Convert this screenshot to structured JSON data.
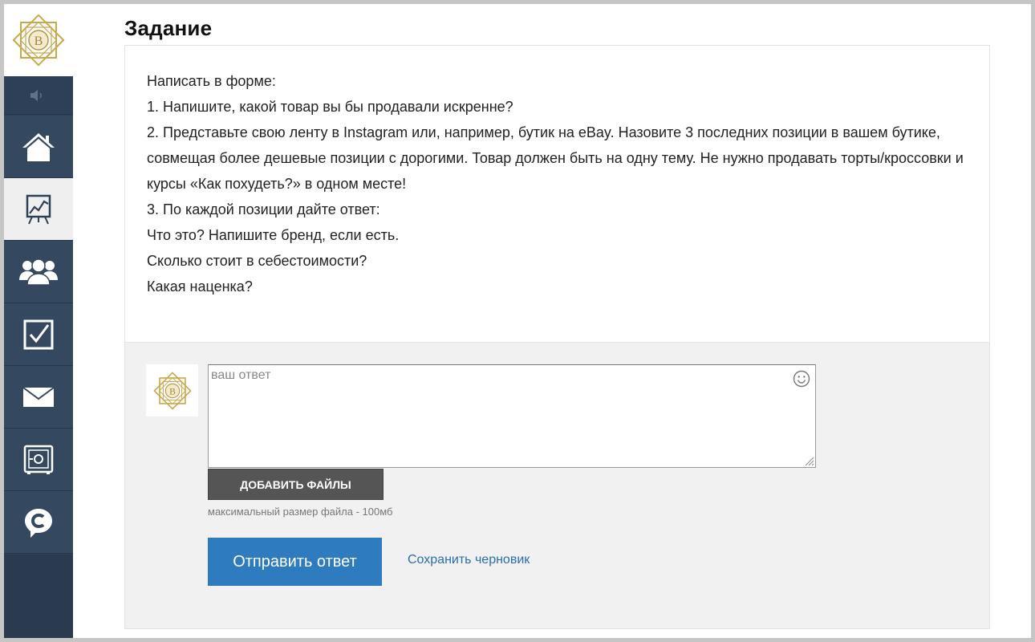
{
  "page": {
    "title": "Задание"
  },
  "sidebar": {
    "items": [
      {
        "name": "home",
        "icon": "home-icon",
        "active": false
      },
      {
        "name": "presentation",
        "icon": "presentation-chart-icon",
        "active": true
      },
      {
        "name": "users",
        "icon": "users-group-icon",
        "active": false
      },
      {
        "name": "tasks",
        "icon": "checkbox-icon",
        "active": false
      },
      {
        "name": "messages",
        "icon": "envelope-icon",
        "active": false
      },
      {
        "name": "safe",
        "icon": "safe-icon",
        "active": false
      },
      {
        "name": "chat",
        "icon": "chat-c-icon",
        "active": false
      }
    ]
  },
  "task": {
    "lines": [
      "Написать в форме:",
      "1. Напишите, какой товар вы бы продавали искренне?",
      "2. Представьте свою ленту в Instagram или, например, бутик на eBay. Назовите 3 последних позиции в вашем бутике, совмещая более дешевые позиции с дорогими. Товар должен быть на одну тему. Не нужно продавать торты/кроссовки и курсы «Как похудеть?» в одном месте!",
      "3. По каждой позиции дайте ответ:",
      "Что это? Напишите бренд, если есть.",
      "Сколько стоит в себестоимости?",
      "Какая наценка?"
    ]
  },
  "answer": {
    "placeholder": "ваш ответ",
    "value": "",
    "add_files_label": "ДОБАВИТЬ ФАЙЛЫ",
    "file_note": "максимальный размер файла - 100мб",
    "submit_label": "Отправить ответ",
    "draft_label": "Сохранить черновик"
  },
  "colors": {
    "sidebar": "#34485f",
    "accent": "#2f7bbf",
    "link": "#2a6db0",
    "logo_gold": "#c9a84c"
  }
}
